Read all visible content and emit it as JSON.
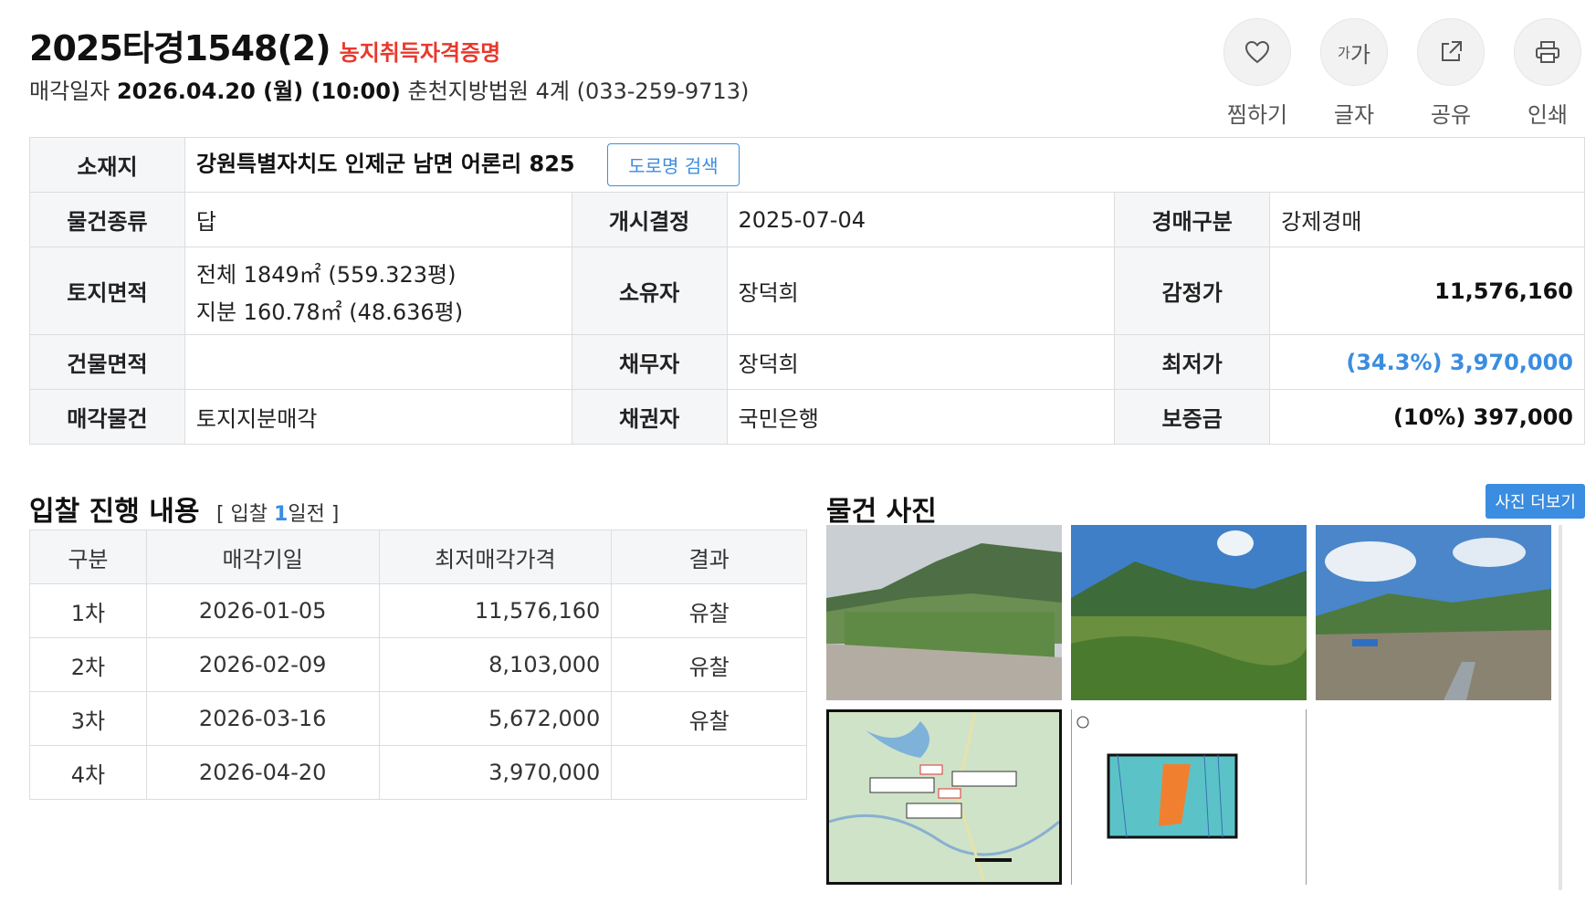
{
  "case": {
    "number": "2025타경1548(2)",
    "tag": "농지취득자격증명",
    "sale_label": "매각일자",
    "sale_datetime": "2026.04.20 (월) (10:00)",
    "court": "춘천지방법원 4계 (033-259-9713)"
  },
  "actions": [
    {
      "label": "찜하기",
      "icon": "heart-icon"
    },
    {
      "label": "글자",
      "icon": "font-size-icon",
      "glyph_small": "가",
      "glyph_big": "가"
    },
    {
      "label": "공유",
      "icon": "share-icon"
    },
    {
      "label": "인쇄",
      "icon": "print-icon"
    }
  ],
  "info": {
    "location_label": "소재지",
    "location": "강원특별자치도 인제군 남면 어론리 825",
    "road_search": "도로명 검색",
    "kind_label": "물건종류",
    "kind": "답",
    "start_label": "개시결정",
    "start": "2025-07-04",
    "type_label": "경매구분",
    "type": "강제경매",
    "land_label": "토지면적",
    "land_total": "전체 1849㎡ (559.323평)",
    "land_share": "지분 160.78㎡ (48.636평)",
    "owner_label": "소유자",
    "owner": "장덕희",
    "appraisal_label": "감정가",
    "appraisal": "11,576,160",
    "building_label": "건물면적",
    "building": "",
    "debtor_label": "채무자",
    "debtor": "장덕희",
    "minimum_label": "최저가",
    "minimum": "(34.3%) 3,970,000",
    "sale_item_label": "매각물건",
    "sale_item": "토지지분매각",
    "creditor_label": "채권자",
    "creditor": "국민은행",
    "deposit_label": "보증금",
    "deposit": "(10%) 397,000"
  },
  "bidding": {
    "title": "입찰 진행 내용",
    "sub_prefix": "[ 입찰 ",
    "sub_days": "1",
    "sub_suffix": "일전 ]",
    "headers": [
      "구분",
      "매각기일",
      "최저매각가격",
      "결과"
    ],
    "rows": [
      {
        "round": "1차",
        "date": "2026-01-05",
        "price": "11,576,160",
        "result": "유찰"
      },
      {
        "round": "2차",
        "date": "2026-02-09",
        "price": "8,103,000",
        "result": "유찰"
      },
      {
        "round": "3차",
        "date": "2026-03-16",
        "price": "5,672,000",
        "result": "유찰"
      },
      {
        "round": "4차",
        "date": "2026-04-20",
        "price": "3,970,000",
        "result": ""
      }
    ]
  },
  "photos": {
    "title": "물건 사진",
    "more": "사진 더보기"
  }
}
